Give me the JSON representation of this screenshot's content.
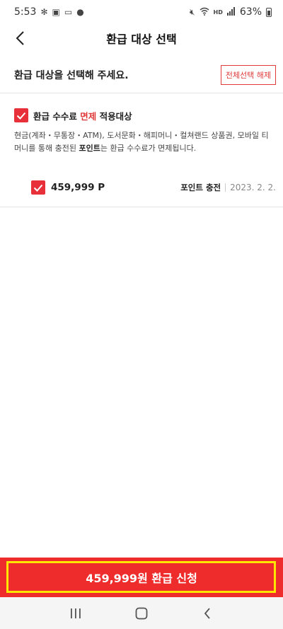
{
  "status_bar": {
    "time": "5:53",
    "battery": "63%",
    "left_icons": [
      "settings-icon",
      "photo-icon",
      "card-icon",
      "dot-icon"
    ],
    "right_icons": [
      "mute-icon",
      "wifi-icon",
      "hd-icon",
      "signal-icon",
      "battery-icon"
    ],
    "hd_label": "HD"
  },
  "header": {
    "title": "환급 대상 선택"
  },
  "sub_header": {
    "instruction": "환급 대상을 선택해 주세요.",
    "deselect_all_label": "전체선택 해제"
  },
  "refund_group": {
    "label_prefix": "환급 수수료 ",
    "label_highlight": "면제",
    "label_suffix": " 적용대상",
    "checked": true,
    "description_part1": "현금(계좌・무통장・ATM), 도서문화・해피머니・컬쳐랜드 상품권, 모바일 티머니를 통해 충전된 ",
    "description_bold": "포인트",
    "description_part2": "는 환급 수수료가 면제됩니다.",
    "items": [
      {
        "amount": "459,999 P",
        "type": "포인트 충전",
        "date": "2023. 2. 2.",
        "checked": true
      }
    ]
  },
  "submit": {
    "label": "459,999원 환급 신청"
  },
  "colors": {
    "accent": "#e8303a",
    "highlight_border": "#ffe600"
  }
}
